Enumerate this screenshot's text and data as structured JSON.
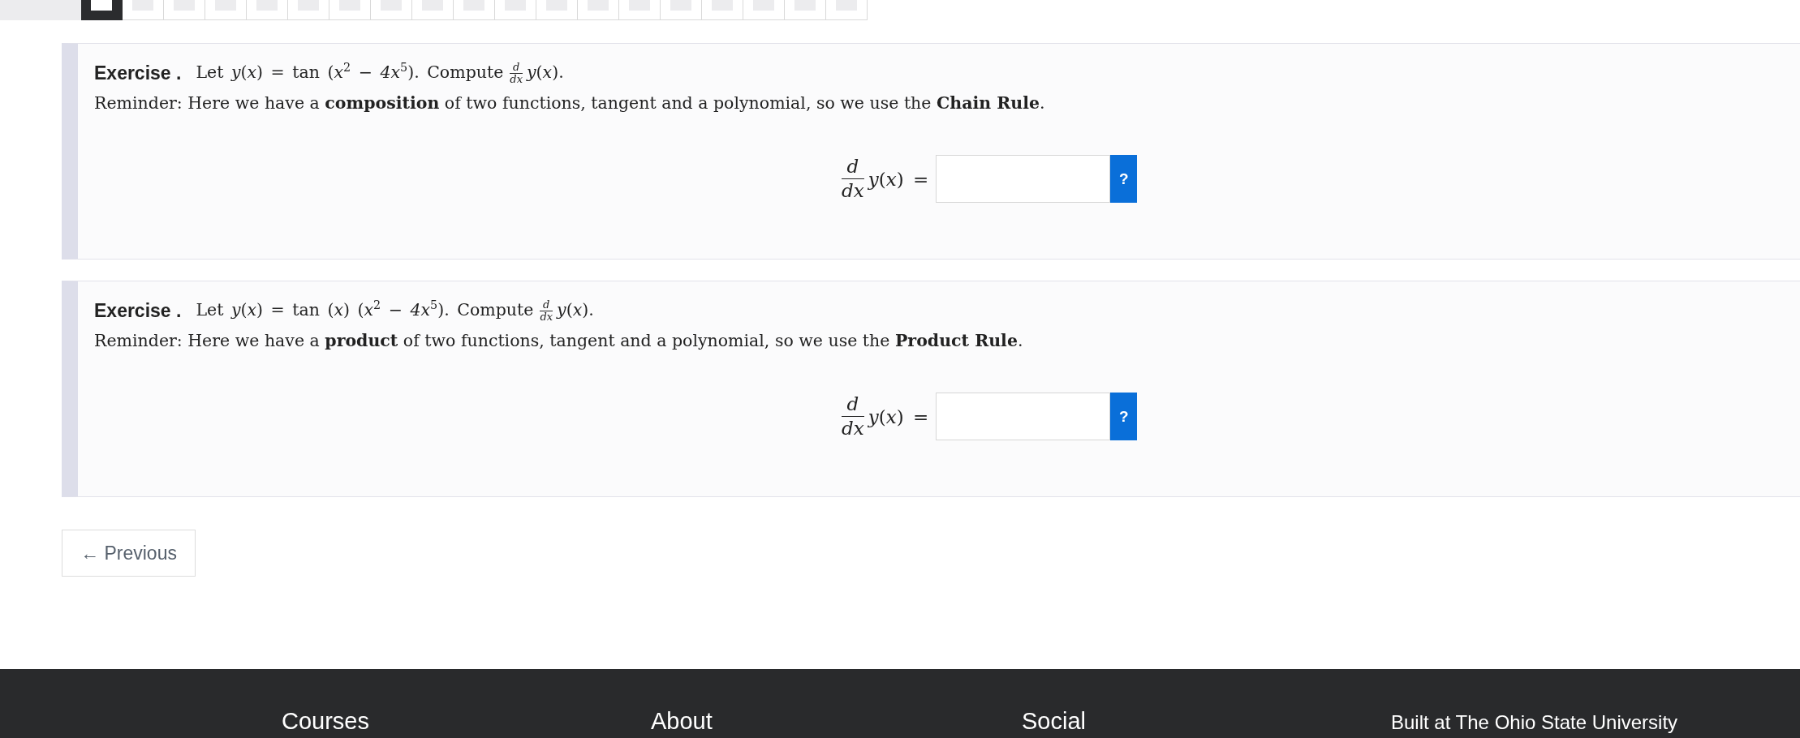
{
  "page_tiles": [
    {
      "selected": true
    },
    {
      "selected": false
    },
    {
      "selected": false
    },
    {
      "selected": false
    },
    {
      "selected": false
    },
    {
      "selected": false
    },
    {
      "selected": false
    },
    {
      "selected": false
    },
    {
      "selected": false
    },
    {
      "selected": false
    },
    {
      "selected": false
    },
    {
      "selected": false
    },
    {
      "selected": false
    },
    {
      "selected": false
    },
    {
      "selected": false
    },
    {
      "selected": false
    },
    {
      "selected": false
    },
    {
      "selected": false
    },
    {
      "selected": false
    }
  ],
  "exercises": [
    {
      "label": "Exercise .",
      "statement": "Let *y*(*x*) = tan (*x*$^{2}$ − *4x*$^{5}$). Compute",
      "fraction": {
        "numerator": "*d*",
        "denominator": "*dx*"
      },
      "statement_end": "*y*(*x*).",
      "reminder": "Reminder: Here we have a **composition** of two functions, tangent and a polynomial, so we use the **Chain Rule**.",
      "equation": {
        "numerator": "*d*",
        "denominator": "*dx*",
        "lhs": "*y*(*x*) =",
        "help_button": "?"
      }
    },
    {
      "label": "Exercise .",
      "statement": "Let *y*(*x*) = tan (*x*) (*x*$^{2}$ − *4x*$^{5}$). Compute",
      "fraction": {
        "numerator": "*d*",
        "denominator": "*dx*"
      },
      "statement_end": "*y*(*x*).",
      "reminder": "Reminder: Here we have a **product** of two functions, tangent and a polynomial, so we use the **Product Rule**.",
      "equation": {
        "numerator": "*d*",
        "denominator": "*dx*",
        "lhs": "*y*(*x*) =",
        "help_button": "?"
      }
    }
  ],
  "previous_button": "← Previous",
  "footer": {
    "headings": [
      "Courses",
      "About",
      "Social"
    ],
    "credit": "Built at The Ohio State University"
  }
}
